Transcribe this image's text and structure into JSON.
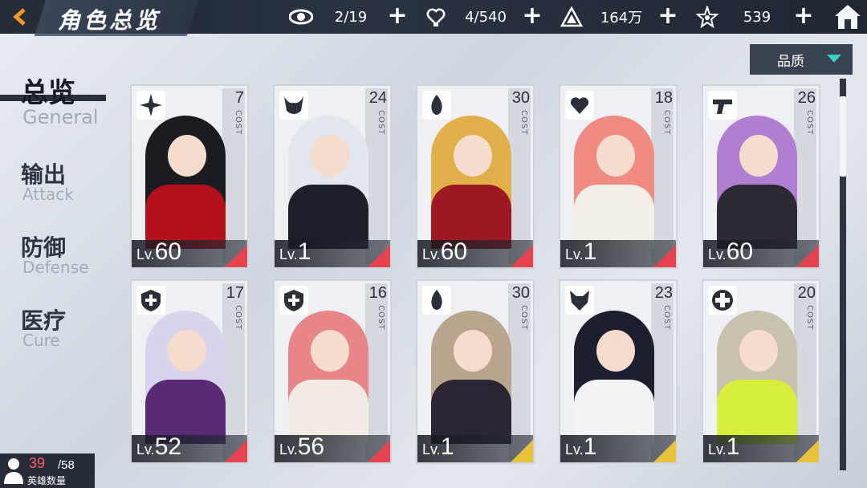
{
  "header": {
    "title": "角色总览",
    "resources": [
      {
        "icon": "eye-icon",
        "value": "2/19"
      },
      {
        "icon": "heart-hand-icon",
        "value": "4/540"
      },
      {
        "icon": "triangle-crystal-icon",
        "value": "164万"
      },
      {
        "icon": "star-crystal-icon",
        "value": "539"
      }
    ]
  },
  "nav": {
    "items": [
      {
        "cn": "总览",
        "en": "General",
        "active": true
      },
      {
        "cn": "输出",
        "en": "Attack"
      },
      {
        "cn": "防御",
        "en": "Defense"
      },
      {
        "cn": "医疗",
        "en": "Cure"
      }
    ]
  },
  "filter": {
    "label": "品质"
  },
  "cards": [
    {
      "level_prefix": "Lv.",
      "level": "60",
      "cost": "7",
      "cost_label": "COST",
      "role_icon": "shuriken-icon",
      "rarity": "red",
      "hair": "#1b1b22",
      "outfit": "#b3121c"
    },
    {
      "level_prefix": "Lv.",
      "level": "1",
      "cost": "24",
      "cost_label": "COST",
      "role_icon": "horned-helmet-icon",
      "rarity": "red",
      "hair": "#e3e6ec",
      "outfit": "#1d1f2a"
    },
    {
      "level_prefix": "Lv.",
      "level": "60",
      "cost": "30",
      "cost_label": "COST",
      "role_icon": "flame-icon",
      "rarity": "red",
      "hair": "#e2b04a",
      "outfit": "#9d1820"
    },
    {
      "level_prefix": "Lv.",
      "level": "1",
      "cost": "18",
      "cost_label": "COST",
      "role_icon": "winged-heart-icon",
      "rarity": "red",
      "hair": "#ef8b80",
      "outfit": "#f4efe6"
    },
    {
      "level_prefix": "Lv.",
      "level": "60",
      "cost": "26",
      "cost_label": "COST",
      "role_icon": "gun-icon",
      "rarity": "red",
      "hair": "#b17fd2",
      "outfit": "#2d2a33"
    },
    {
      "level_prefix": "Lv.",
      "level": "52",
      "cost": "17",
      "cost_label": "COST",
      "role_icon": "shield-cross-icon",
      "rarity": "red",
      "hair": "#d9d4ee",
      "outfit": "#5a2a74"
    },
    {
      "level_prefix": "Lv.",
      "level": "56",
      "cost": "16",
      "cost_label": "COST",
      "role_icon": "shield-cross-icon",
      "rarity": "red",
      "hair": "#e88589",
      "outfit": "#f1ebe3"
    },
    {
      "level_prefix": "Lv.",
      "level": "1",
      "cost": "30",
      "cost_label": "COST",
      "role_icon": "flame-icon",
      "rarity": "gold",
      "hair": "#b9a48d",
      "outfit": "#2b2534"
    },
    {
      "level_prefix": "Lv.",
      "level": "1",
      "cost": "23",
      "cost_label": "COST",
      "role_icon": "fox-mask-icon",
      "rarity": "gold",
      "hair": "#1e1f2e",
      "outfit": "#f3f3f6"
    },
    {
      "level_prefix": "Lv.",
      "level": "1",
      "cost": "20",
      "cost_label": "COST",
      "role_icon": "medic-shield-icon",
      "rarity": "gold",
      "hair": "#c8c1ae",
      "outfit": "#d7ee3c"
    }
  ],
  "hero_count": {
    "current": "39",
    "max": "/58",
    "label": "英雄数量"
  }
}
